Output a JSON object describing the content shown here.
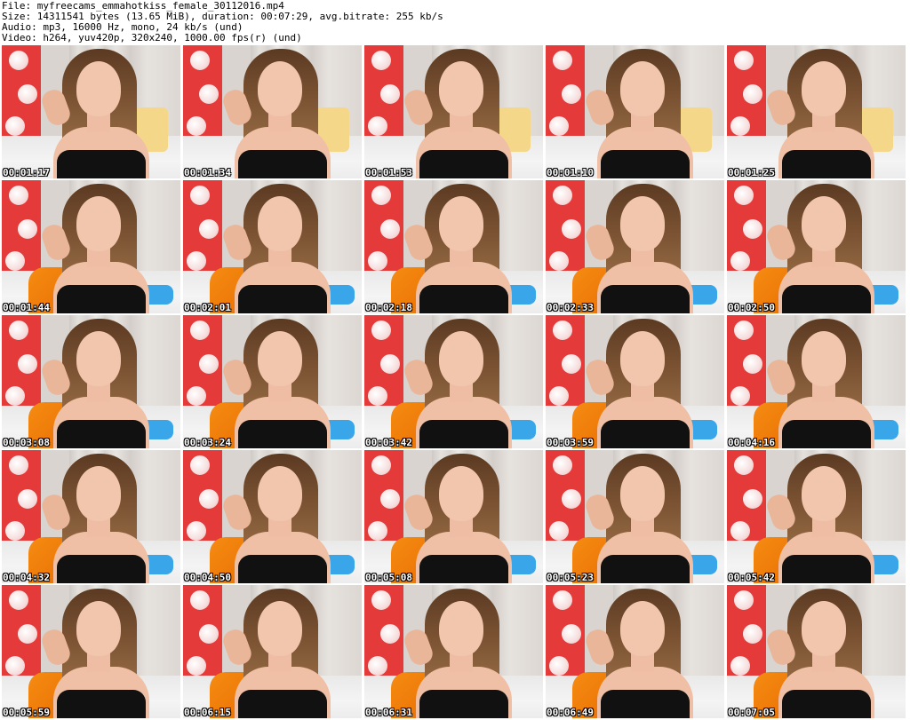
{
  "header": {
    "file": "File: myfreecams_emmahotkiss_female_30112016.mp4",
    "size": "Size: 14311541 bytes (13.65 MiB), duration: 00:07:29, avg.bitrate: 255 kb/s",
    "audio": "Audio: mp3, 16000 Hz, mono, 24 kb/s (und)",
    "video": "Video: h264, yuv420p, 320x240, 1000.00 fps(r) (und)"
  },
  "thumbnails": [
    {
      "timestamp": "00:01:17"
    },
    {
      "timestamp": "00:01:34"
    },
    {
      "timestamp": "00:01:53"
    },
    {
      "timestamp": "00:01:10"
    },
    {
      "timestamp": "00:01:25"
    },
    {
      "timestamp": "00:01:44"
    },
    {
      "timestamp": "00:02:01"
    },
    {
      "timestamp": "00:02:18"
    },
    {
      "timestamp": "00:02:33"
    },
    {
      "timestamp": "00:02:50"
    },
    {
      "timestamp": "00:03:08"
    },
    {
      "timestamp": "00:03:24"
    },
    {
      "timestamp": "00:03:42"
    },
    {
      "timestamp": "00:03:59"
    },
    {
      "timestamp": "00:04:16"
    },
    {
      "timestamp": "00:04:32"
    },
    {
      "timestamp": "00:04:50"
    },
    {
      "timestamp": "00:05:08"
    },
    {
      "timestamp": "00:05:23"
    },
    {
      "timestamp": "00:05:42"
    },
    {
      "timestamp": "00:05:59"
    },
    {
      "timestamp": "00:06:15"
    },
    {
      "timestamp": "00:06:31"
    },
    {
      "timestamp": "00:06:49"
    },
    {
      "timestamp": "00:07:05"
    }
  ]
}
